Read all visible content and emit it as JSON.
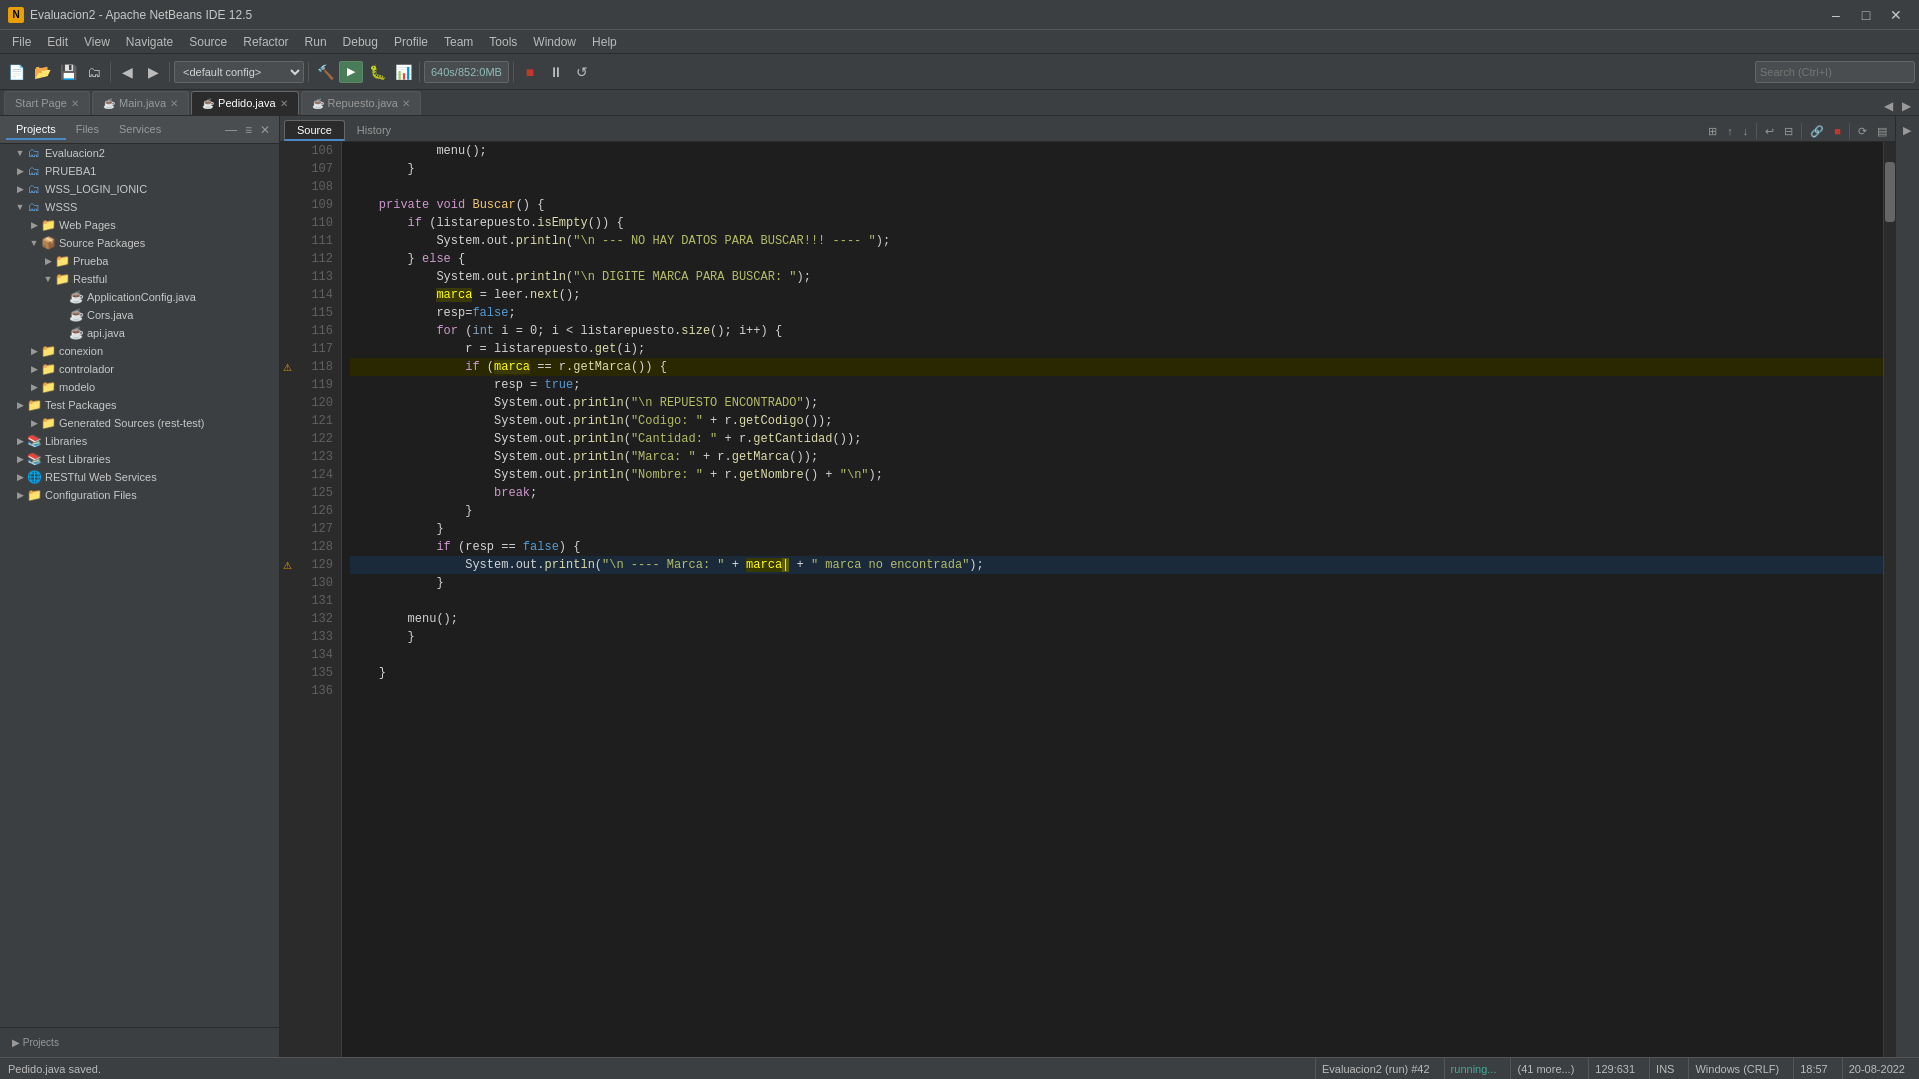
{
  "titleBar": {
    "title": "Evaluacion2 - Apache NetBeans IDE 12.5",
    "icon": "NB"
  },
  "menuBar": {
    "items": [
      "File",
      "Edit",
      "View",
      "Navigate",
      "Source",
      "Refactor",
      "Run",
      "Debug",
      "Profile",
      "Team",
      "Tools",
      "Window",
      "Help"
    ]
  },
  "toolbar": {
    "configDropdown": "<default config>",
    "memLabel": "640s/852:0MB",
    "searchPlaceholder": "Search (Ctrl+I)"
  },
  "topTabs": {
    "items": [
      {
        "label": "Start Page",
        "closable": true,
        "active": false
      },
      {
        "label": "Main.java",
        "closable": true,
        "active": false
      },
      {
        "label": "Pedido.java",
        "closable": true,
        "active": true
      },
      {
        "label": "Repuesto.java",
        "closable": true,
        "active": false
      }
    ]
  },
  "editorTabs": {
    "source": "Source",
    "history": "History"
  },
  "sidebar": {
    "tabs": [
      "Projects",
      "Files",
      "Services"
    ],
    "activeTab": "Projects",
    "tree": [
      {
        "level": 0,
        "label": "Evaluacion2",
        "icon": "📁",
        "arrow": "▼",
        "expanded": true
      },
      {
        "level": 1,
        "label": "PRUEBA1",
        "icon": "📁",
        "arrow": "▶",
        "expanded": false
      },
      {
        "level": 1,
        "label": "WSS_LOGIN_IONIC",
        "icon": "📁",
        "arrow": "▶",
        "expanded": false
      },
      {
        "level": 1,
        "label": "WSSS",
        "icon": "📁",
        "arrow": "▼",
        "expanded": true
      },
      {
        "level": 2,
        "label": "Web Pages",
        "icon": "📁",
        "arrow": "▶",
        "expanded": false
      },
      {
        "level": 2,
        "label": "Source Packages",
        "icon": "📦",
        "arrow": "▼",
        "expanded": true
      },
      {
        "level": 3,
        "label": "Prueba",
        "icon": "📁",
        "arrow": "▶",
        "expanded": false
      },
      {
        "level": 3,
        "label": "Restful",
        "icon": "📁",
        "arrow": "▼",
        "expanded": true
      },
      {
        "level": 4,
        "label": "ApplicationConfig.java",
        "icon": "☕",
        "arrow": "",
        "expanded": false
      },
      {
        "level": 4,
        "label": "Cors.java",
        "icon": "☕",
        "arrow": "",
        "expanded": false
      },
      {
        "level": 4,
        "label": "api.java",
        "icon": "☕",
        "arrow": "",
        "expanded": false
      },
      {
        "level": 2,
        "label": "conexion",
        "icon": "📁",
        "arrow": "▶",
        "expanded": false
      },
      {
        "level": 2,
        "label": "controlador",
        "icon": "📁",
        "arrow": "▶",
        "expanded": false
      },
      {
        "level": 2,
        "label": "modelo",
        "icon": "📁",
        "arrow": "▶",
        "expanded": false
      },
      {
        "level": 1,
        "label": "Test Packages",
        "icon": "📁",
        "arrow": "▶",
        "expanded": false
      },
      {
        "level": 2,
        "label": "Generated Sources (rest-test)",
        "icon": "📁",
        "arrow": "▶",
        "expanded": false
      },
      {
        "level": 1,
        "label": "Libraries",
        "icon": "📚",
        "arrow": "▶",
        "expanded": false
      },
      {
        "level": 1,
        "label": "Test Libraries",
        "icon": "📚",
        "arrow": "▶",
        "expanded": false
      },
      {
        "level": 1,
        "label": "RESTful Web Services",
        "icon": "🌐",
        "arrow": "▶",
        "expanded": false
      },
      {
        "level": 1,
        "label": "Configuration Files",
        "icon": "📁",
        "arrow": "▶",
        "expanded": false
      }
    ]
  },
  "codeEditor": {
    "filename": "Pedido.java",
    "lines": [
      {
        "num": 106,
        "code": "            menu();",
        "type": "plain"
      },
      {
        "num": 107,
        "code": "        }",
        "type": "plain"
      },
      {
        "num": 108,
        "code": "",
        "type": "plain"
      },
      {
        "num": 109,
        "code": "    private void Buscar() {",
        "type": "plain"
      },
      {
        "num": 110,
        "code": "        if (listarepuesto.isEmpty()) {",
        "type": "plain"
      },
      {
        "num": 111,
        "code": "            System.out.println(\"\\n --- NO HAY DATOS PARA BUSCAR!!! ---- \");",
        "type": "plain"
      },
      {
        "num": 112,
        "code": "        } else {",
        "type": "plain"
      },
      {
        "num": 113,
        "code": "            System.out.println(\"\\n DIGITE MARCA PARA BUSCAR: \");",
        "type": "plain"
      },
      {
        "num": 114,
        "code": "            marca = leer.next();",
        "type": "plain"
      },
      {
        "num": 115,
        "code": "            resp=false;",
        "type": "plain"
      },
      {
        "num": 116,
        "code": "            for (int i = 0; i < listarepuesto.size(); i++) {",
        "type": "plain"
      },
      {
        "num": 117,
        "code": "                r = listarepuesto.get(i);",
        "type": "plain"
      },
      {
        "num": 118,
        "code": "                if (marca == r.getMarca()) {",
        "type": "plain",
        "warning": true
      },
      {
        "num": 119,
        "code": "                    resp = true;",
        "type": "plain"
      },
      {
        "num": 120,
        "code": "                    System.out.println(\"\\n REPUESTO ENCONTRADO\");",
        "type": "plain"
      },
      {
        "num": 121,
        "code": "                    System.out.println(\"Codigo: \" + r.getCodigo());",
        "type": "plain"
      },
      {
        "num": 122,
        "code": "                    System.out.println(\"Cantidad: \" + r.getCantidad());",
        "type": "plain"
      },
      {
        "num": 123,
        "code": "                    System.out.println(\"Marca: \" + r.getMarca());",
        "type": "plain"
      },
      {
        "num": 124,
        "code": "                    System.out.println(\"Nombre: \" + r.getNombre() + \"\\n\");",
        "type": "plain"
      },
      {
        "num": 125,
        "code": "                    break;",
        "type": "plain"
      },
      {
        "num": 126,
        "code": "                }",
        "type": "plain"
      },
      {
        "num": 127,
        "code": "            }",
        "type": "plain"
      },
      {
        "num": 128,
        "code": "            if (resp == false) {",
        "type": "plain"
      },
      {
        "num": 129,
        "code": "                System.out.println(\"\\n ---- Marca: \" + marca + \" marca no encontrada\");",
        "type": "highlighted",
        "warning": true
      },
      {
        "num": 130,
        "code": "            }",
        "type": "plain"
      },
      {
        "num": 131,
        "code": "",
        "type": "plain"
      },
      {
        "num": 132,
        "code": "        menu();",
        "type": "plain"
      },
      {
        "num": 133,
        "code": "        }",
        "type": "plain"
      },
      {
        "num": 134,
        "code": "",
        "type": "plain"
      },
      {
        "num": 135,
        "code": "    }",
        "type": "plain"
      },
      {
        "num": 136,
        "code": "",
        "type": "plain"
      }
    ]
  },
  "statusBar": {
    "message": "Pedido.java saved.",
    "project": "Evaluacion2 (run) #42",
    "status": "running...",
    "moreItems": "(41 more...)",
    "position": "129:631",
    "mode": "INS",
    "encoding": "Windows (CRLF)"
  },
  "time": "18:57",
  "date": "20-08-2022"
}
